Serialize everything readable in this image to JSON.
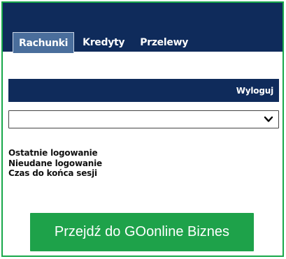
{
  "nav": {
    "tabs": [
      {
        "label": "Rachunki",
        "active": true
      },
      {
        "label": "Kredyty",
        "active": false
      },
      {
        "label": "Przelewy",
        "active": false
      }
    ]
  },
  "header": {
    "logout_label": "Wyloguj"
  },
  "account_select": {
    "value": ""
  },
  "session_info": {
    "last_login_label": "Ostatnie logowanie",
    "failed_login_label": "Nieudane logowanie",
    "session_time_label": "Czas do końca sesji"
  },
  "cta": {
    "label": "Przejdź do GOonline Biznes"
  },
  "colors": {
    "navy": "#0f2b5b",
    "active_tab": "#4a6e9c",
    "green": "#1ea24a",
    "frame_green": "#18a84a"
  },
  "icons": {
    "select_arrow": "chevron-down-icon"
  }
}
